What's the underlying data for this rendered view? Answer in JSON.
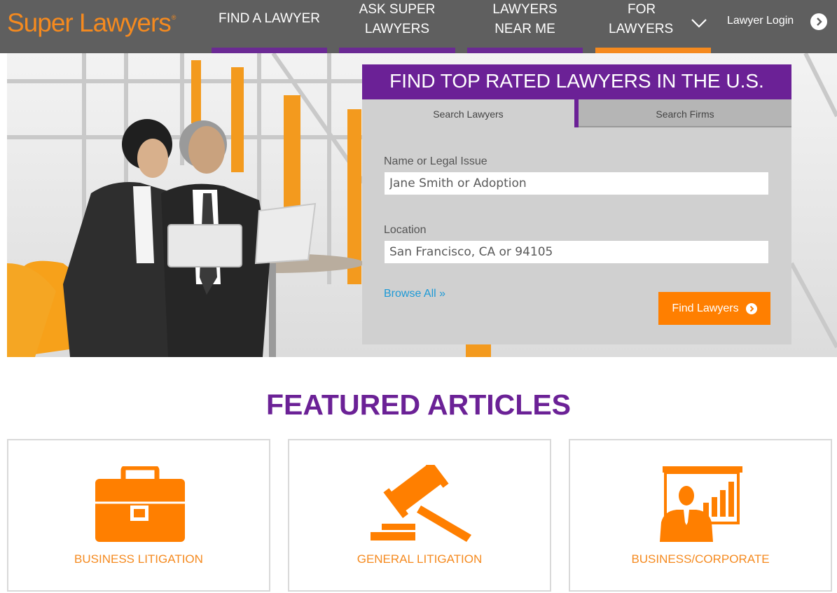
{
  "header": {
    "logo": "Super Lawyers",
    "logo_mark": "®",
    "nav": [
      {
        "line1": "FIND A LAWYER",
        "line2": ""
      },
      {
        "line1": "ASK SUPER",
        "line2": "LAWYERS"
      },
      {
        "line1": "LAWYERS",
        "line2": "NEAR ME"
      },
      {
        "line1": "FOR",
        "line2": "LAWYERS"
      }
    ],
    "login_label": "Lawyer Login"
  },
  "search": {
    "title": "FIND TOP RATED LAWYERS IN THE U.S.",
    "tabs": [
      "Search Lawyers",
      "Search Firms"
    ],
    "name_label": "Name or Legal Issue",
    "name_placeholder": "Jane Smith or Adoption",
    "location_label": "Location",
    "location_placeholder": "San Francisco, CA or 94105",
    "browse_label": "Browse All »",
    "button_label": "Find Lawyers"
  },
  "featured": {
    "title": "FEATURED ARTICLES",
    "cards": [
      {
        "label": "BUSINESS LITIGATION",
        "icon": "briefcase-icon"
      },
      {
        "label": "GENERAL LITIGATION",
        "icon": "gavel-icon"
      },
      {
        "label": "BUSINESS/CORPORATE",
        "icon": "presentation-icon"
      }
    ]
  },
  "colors": {
    "purple": "#6b2196",
    "orange": "#ff7f00",
    "header_gray": "#5f5f5f",
    "link_blue": "#1e9ad6"
  }
}
